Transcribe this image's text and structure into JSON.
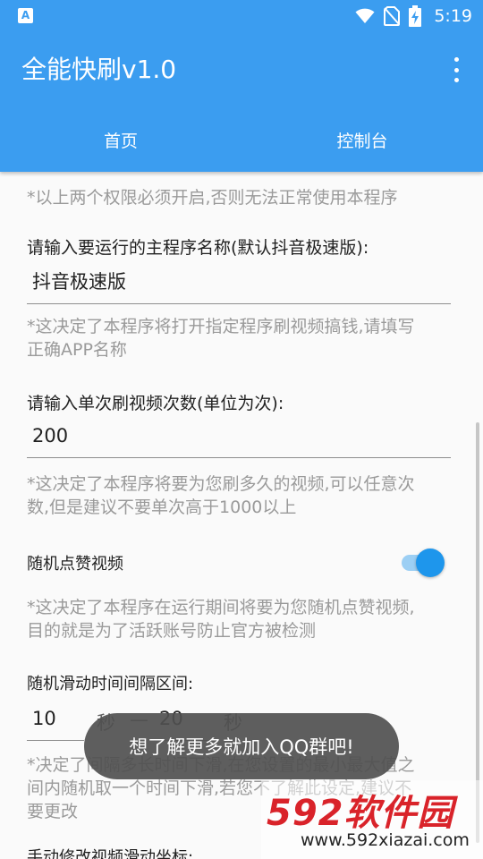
{
  "status_bar": {
    "left_icon_letter": "A",
    "time": "5:19",
    "icons": [
      "wifi-icon",
      "no-sim-icon",
      "battery-charging-icon"
    ]
  },
  "app_bar": {
    "title": "全能快刷v1.0",
    "menu_icon": "more-vert-icon",
    "color": "#3b9df0"
  },
  "tabs": [
    {
      "label": "首页"
    },
    {
      "label": "控制台"
    }
  ],
  "content": {
    "permission_hint": "*以上两个权限必须开启,否则无法正常使用本程序",
    "app_name": {
      "label": "请输入要运行的主程序名称(默认抖音极速版):",
      "value": "抖音极速版",
      "hint_line1": "*这决定了本程序将打开指定程序刷视频搞钱,请填写",
      "hint_line2": "正确APP名称"
    },
    "count": {
      "label": "请输入单次刷视频次数(单位为次):",
      "value": "200",
      "hint_line1": "*这决定了本程序将要为您刷多久的视频,可以任意次",
      "hint_line2": "数,但是建议不要单次高于1000以上"
    },
    "random_like": {
      "label": "随机点赞视频",
      "enabled": true,
      "hint_line1": "*这决定了本程序在运行期间将要为您随机点赞视频,",
      "hint_line2": "目的就是为了活跃账号防止官方被检测"
    },
    "interval": {
      "label": "随机滑动时间间隔区间:",
      "min_value": "10",
      "min_unit": "秒",
      "dash": "—",
      "max_value": "20",
      "max_unit": "秒",
      "hint_line1": "*决定了间隔多长时间下滑,在您设置的最小最大值之",
      "hint_line2": "间内随机取一个时间下滑,若您不了解此设定,建议不",
      "hint_line3": "要更改"
    },
    "next_label": "手动修改视频滑动坐标:"
  },
  "toast": "想了解更多就加入QQ群吧!",
  "watermark": {
    "main": "592软件园",
    "url": "www.592xiazai.com"
  }
}
